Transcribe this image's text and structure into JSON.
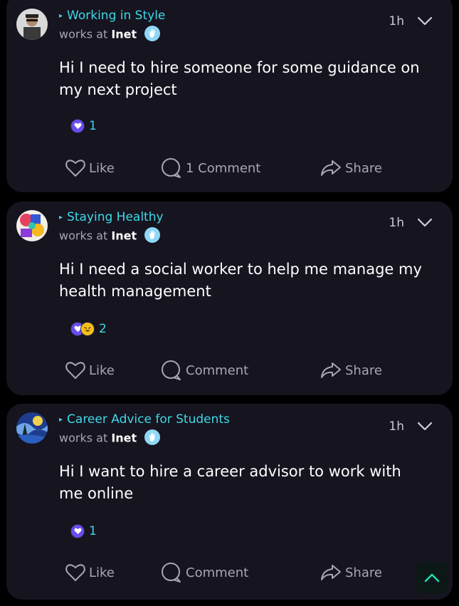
{
  "posts": [
    {
      "group": "Working in Style",
      "works_prefix": "works at",
      "company": "Inet",
      "time": "1h",
      "text": "Hi I need to hire someone for some guidance on my next project",
      "reaction_count": "1",
      "reactions": [
        "heart"
      ],
      "like_label": "Like",
      "comment_label": "1 Comment",
      "share_label": "Share"
    },
    {
      "group": "Staying Healthy",
      "works_prefix": "works at",
      "company": "Inet",
      "time": "1h",
      "text": "Hi I need a social worker to help me manage my health management",
      "reaction_count": "2",
      "reactions": [
        "heart",
        "laugh"
      ],
      "like_label": "Like",
      "comment_label": "Comment",
      "share_label": "Share"
    },
    {
      "group": "Career Advice for Students",
      "works_prefix": "works at",
      "company": "Inet",
      "time": "1h",
      "text": "Hi I want to hire a career advisor to work with me online",
      "reaction_count": "1",
      "reactions": [
        "heart"
      ],
      "like_label": "Like",
      "comment_label": "Comment",
      "share_label": "Share"
    }
  ],
  "icons": {
    "group_marker": "▸",
    "company_badge": "wave-hand-badge-icon",
    "menu": "chevron-down-icon",
    "like": "heart-outline-icon",
    "comment": "comment-bubble-icon",
    "share": "share-arrow-icon",
    "scroll_top": "chevron-up-icon"
  },
  "colors": {
    "background": "#000000",
    "card": "#15141f",
    "accent": "#3fd8e8",
    "muted_text": "#a7a6b2",
    "heart_reaction": "#6b4cf0",
    "laugh_reaction": "#f5c01d",
    "scroll_button": "#0c1816",
    "scroll_icon": "#1fd8b0"
  }
}
